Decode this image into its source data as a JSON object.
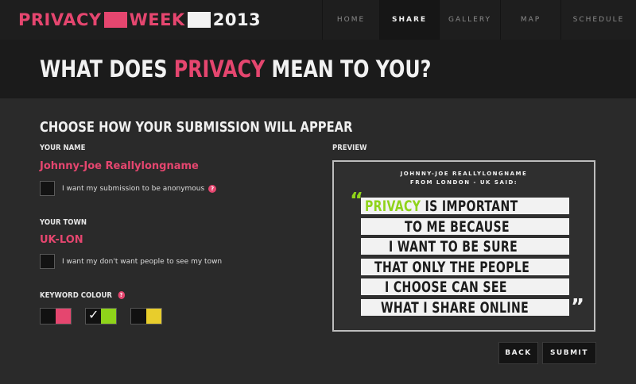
{
  "logo": {
    "word1": "PRIVACY",
    "word2": "WEEK",
    "year": "2013"
  },
  "nav": {
    "items": [
      "HOME",
      "SHARE",
      "GALLERY",
      "MAP",
      "SCHEDULE"
    ],
    "active": "SHARE"
  },
  "page": {
    "title_pre": "WHAT DOES ",
    "title_highlight": "PRIVACY",
    "title_post": " MEAN TO YOU?"
  },
  "form": {
    "section_title": "CHOOSE HOW YOUR SUBMISSION WILL APPEAR",
    "name_label": "YOUR NAME",
    "name_value": "Johnny-Joe Reallylongname",
    "anonymous_label": "I want my submission to be anonymous",
    "town_label": "YOUR TOWN",
    "town_value": "UK-LON",
    "hide_town_label": "I want my don't want people to see my town",
    "keyword_colour_label": "KEYWORD COLOUR",
    "help_glyph": "?",
    "swatches": [
      {
        "colour": "#e5466f",
        "selected": false
      },
      {
        "colour": "#8fd31a",
        "selected": true
      },
      {
        "colour": "#e8cd2c",
        "selected": false
      }
    ],
    "accent_colour": "#e5466f",
    "keyword_colour": "#8fd31a"
  },
  "preview": {
    "label": "PREVIEW",
    "name": "JOHNNY-JOE REALLYLONGNAME",
    "from": "FROM LONDON - UK SAID:",
    "open_quote": "“",
    "close_quote": "”",
    "keyword": "PRIVACY",
    "line1_rest": " IS IMPORTANT",
    "lines": [
      "TO ME BECAUSE",
      "I WANT TO BE SURE",
      "THAT ONLY THE PEOPLE",
      "I CHOOSE CAN SEE",
      "WHAT I SHARE ONLINE"
    ]
  },
  "buttons": {
    "back": "BACK",
    "submit": "SUBMIT"
  }
}
